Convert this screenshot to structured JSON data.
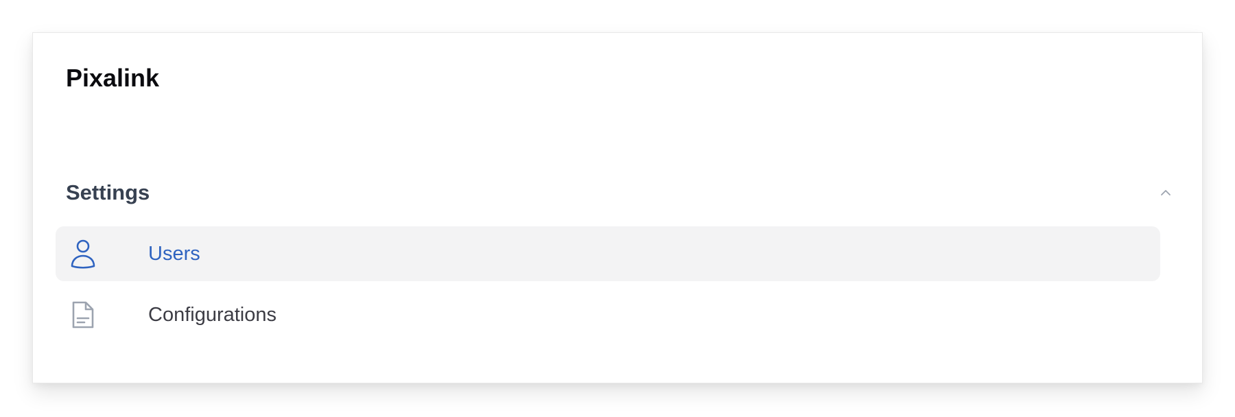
{
  "app": {
    "title": "Pixalink"
  },
  "section": {
    "title": "Settings",
    "expanded": true,
    "toggle_icon": "chevron-up-icon"
  },
  "nav": {
    "items": [
      {
        "label": "Users",
        "icon": "user-icon",
        "active": true
      },
      {
        "label": "Configurations",
        "icon": "document-icon",
        "active": false
      }
    ]
  },
  "colors": {
    "accent": "#2f63c0",
    "active_bg": "#f3f3f4",
    "heading": "#374151",
    "icon_muted": "#9ca3af"
  }
}
